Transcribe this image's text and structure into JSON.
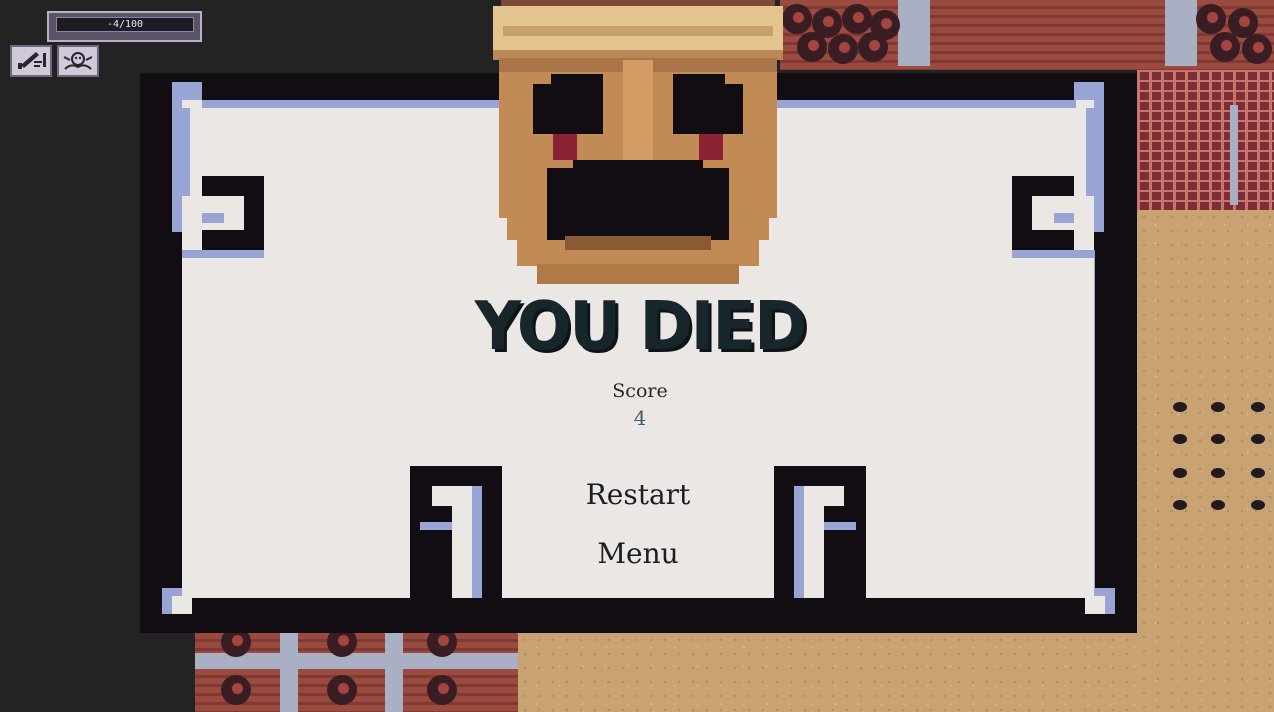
{
  "hud": {
    "health_text": "-4/100",
    "health_value": -4,
    "health_max": 100,
    "slots": [
      {
        "icon": "sword-icon"
      },
      {
        "icon": "creature-icon"
      }
    ]
  },
  "dialog": {
    "title": "YOU DIED",
    "score_label": "Score",
    "score_value": "4",
    "buttons": {
      "restart": "Restart",
      "menu": "Menu"
    }
  },
  "colors": {
    "panel": "#eae7e4",
    "frame": "#120d12",
    "frame_accent": "#98a4d4",
    "title": "#17262b",
    "score_value": "#3f5d77",
    "mask": "#c28a55"
  }
}
